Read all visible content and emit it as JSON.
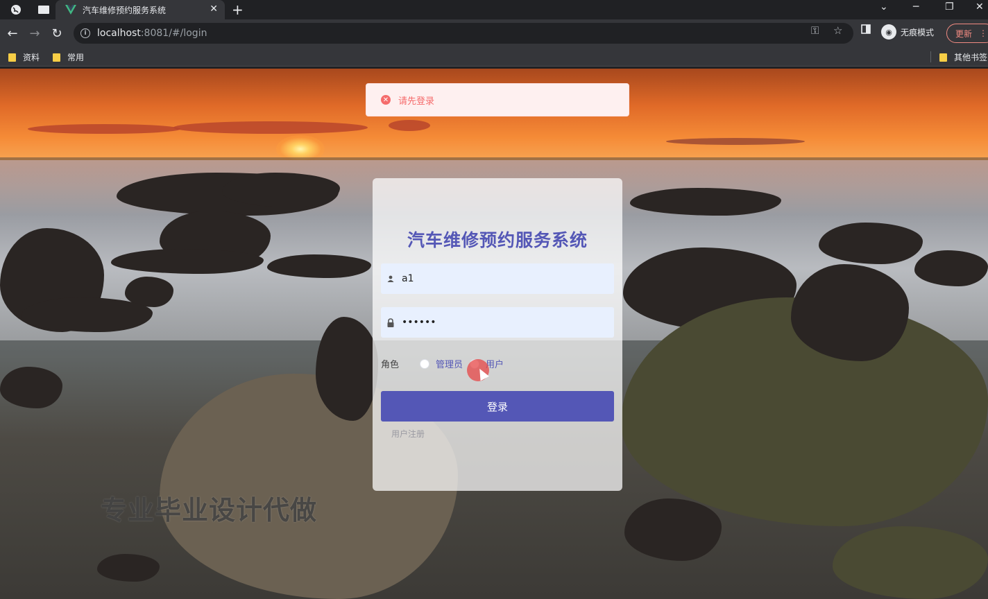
{
  "browser": {
    "tab_title": "汽车维修预约服务系统",
    "new_tab_symbol": "+",
    "url_host": "localhost",
    "url_path": ":8081/#/login",
    "incognito_label": "无痕模式",
    "update_label": "更新",
    "bookmarks": [
      "资料",
      "常用"
    ],
    "other_bookmarks": "其他书签",
    "icons": [
      "globe-icon",
      "window-icon",
      "vue-logo-icon",
      "close-icon",
      "back-icon",
      "forward-icon",
      "reload-icon",
      "info-icon",
      "key-icon",
      "star-icon",
      "sidepanel-icon",
      "incognito-icon",
      "more-icon",
      "folder-icon"
    ]
  },
  "toast": {
    "message": "请先登录",
    "type": "error",
    "color": "#f56c6c"
  },
  "login": {
    "title": "汽车维修预约服务系统",
    "username_value": "a1",
    "password_value": "••••••",
    "role_label": "角色",
    "role_options": [
      "管理员",
      "用户"
    ],
    "submit_label": "登录",
    "register_link": "用户注册",
    "accent_color": "#5457b6"
  },
  "watermark": "专业毕业设计代做"
}
